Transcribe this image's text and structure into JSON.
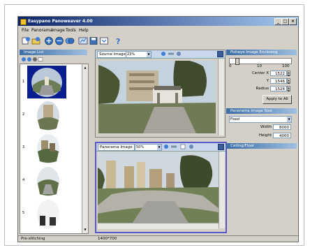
{
  "window": {
    "title": "Easypano Panoweaver 4.00",
    "minimize": "_",
    "maximize": "□",
    "close": "×"
  },
  "menu": [
    "File",
    "Panorama",
    "Image",
    "Tools",
    "Help"
  ],
  "toolbar": {
    "icons": [
      "new-project-icon",
      "open-project-icon",
      "add-image-icon",
      "remove-image-icon",
      "stitch-icon",
      "publish-icon",
      "save-icon",
      "help-icon"
    ]
  },
  "image_list": {
    "header": "Image List",
    "thumbnail_numbers": [
      "1",
      "2",
      "3",
      "4",
      "5"
    ]
  },
  "source_image": {
    "header_label": "Source Image",
    "zoom": "23%"
  },
  "panorama_image": {
    "header_label": "Panorama Image",
    "zoom": "50%"
  },
  "fisheye": {
    "header": "Fisheye Image Enclosing",
    "slider_min": "0",
    "slider_mid": "10",
    "slider_max": "100",
    "center_x_label": "Center X",
    "center_x": "1522",
    "y_label": "Y",
    "center_y": "1546",
    "radius_label": "Radius",
    "radius": "1524",
    "apply_label": "Apply to All"
  },
  "panorama_size": {
    "header": "Panorama Image Size",
    "preset": "Fixed",
    "width_label": "Width",
    "width": "8000",
    "height_label": "Height",
    "height": "4000"
  },
  "ceiling_floor": {
    "header": "Ceiling/Floor"
  },
  "status": {
    "left": "Pre-stitching",
    "size": "1400*700"
  }
}
